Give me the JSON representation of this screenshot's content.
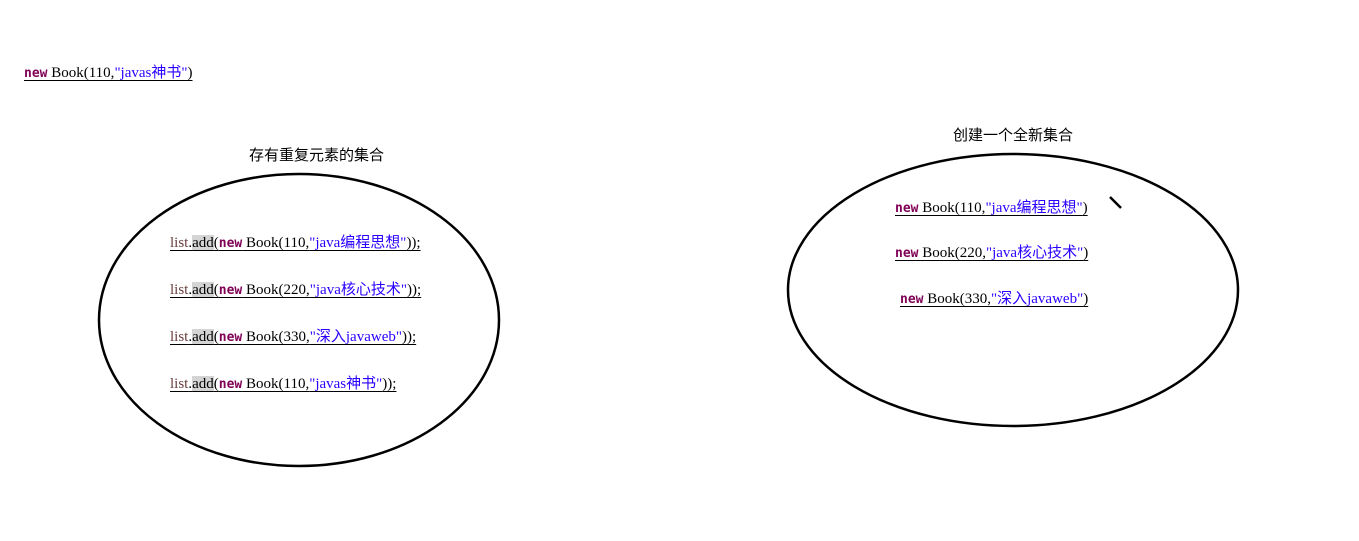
{
  "standalone_line": {
    "keyword": "new",
    "call": " Book(110,",
    "string": "\"javas神书\"",
    "tail": ")"
  },
  "left_set": {
    "caption": "存有重复元素的集合",
    "lines": [
      {
        "var": "list",
        "dot": ".",
        "method": "add",
        "open": "(",
        "keyword": "new",
        "call": " Book(110,",
        "string": "\"java编程思想\"",
        "tail": "));"
      },
      {
        "var": "list",
        "dot": ".",
        "method": "add",
        "open": "(",
        "keyword": "new",
        "call": " Book(220,",
        "string": "\"java核心技术\"",
        "tail": "));"
      },
      {
        "var": "list",
        "dot": ".",
        "method": "add",
        "open": "(",
        "keyword": "new",
        "call": " Book(330,",
        "string": "\"深入javaweb\"",
        "tail": "));"
      },
      {
        "var": "list",
        "dot": ".",
        "method": "add",
        "open": "(",
        "keyword": "new",
        "call": " Book(110,",
        "string": "\"javas神书\"",
        "tail": "));"
      }
    ]
  },
  "right_set": {
    "caption": "创建一个全新集合",
    "lines": [
      {
        "keyword": "new",
        "call": " Book(110,",
        "string": "\"java编程思想\"",
        "tail": ")"
      },
      {
        "keyword": "new",
        "call": " Book(220,",
        "string": "\"java核心技术\"",
        "tail": ")"
      },
      {
        "keyword": "new",
        "call": " Book(330,",
        "string": "\"深入javaweb\"",
        "tail": ")"
      }
    ]
  },
  "colors": {
    "keyword": "#7f0055",
    "string": "#2a00ff",
    "variable": "#6a3e3e",
    "highlight": "#d4d4d4",
    "outline": "#000000"
  }
}
